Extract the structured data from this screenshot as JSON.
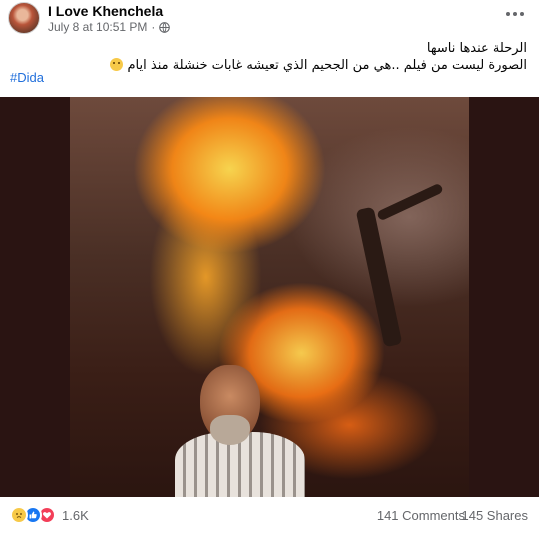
{
  "post": {
    "page_name": "I Love Khenchela",
    "timestamp": "July 8 at 10:51 PM",
    "meta_separator": "·",
    "privacy_icon": "globe-icon",
    "text_line1": "الرحلة عندها ناسها",
    "text_line2": "الصورة ليست من فيلم ..هي من الجحيم الذي تعيشه غابات خنشلة منذ ايام",
    "text_line2_emoji": "disappointed-face",
    "hashtag": "#Dida"
  },
  "engagement": {
    "reactions": [
      "sad",
      "like",
      "love"
    ],
    "reaction_count": "1.6K",
    "comments": "141 Comments",
    "shares": "145 Shares"
  },
  "colors": {
    "link": "#216fdb",
    "secondary_text": "#65676b",
    "like": "#1877f2",
    "love": "#f33e58",
    "sad": "#f7c948"
  }
}
